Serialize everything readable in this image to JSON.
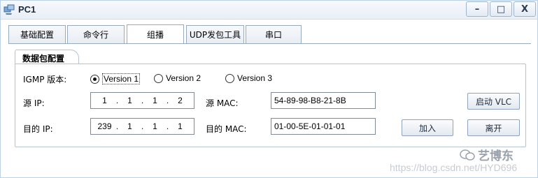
{
  "window": {
    "title": "PC1",
    "controls": {
      "minimize": "–",
      "maximize": "□",
      "close": "X"
    }
  },
  "tabs": [
    {
      "label": "基础配置",
      "active": false
    },
    {
      "label": "命令行",
      "active": false
    },
    {
      "label": "组播",
      "active": true
    },
    {
      "label": "UDP发包工具",
      "active": false
    },
    {
      "label": "串口",
      "active": false
    }
  ],
  "group": {
    "title": "数据包配置",
    "igmp_label": "IGMP 版本:",
    "versions": [
      {
        "label": "Version 1",
        "selected": true
      },
      {
        "label": "Version 2",
        "selected": false
      },
      {
        "label": "Version 3",
        "selected": false
      }
    ],
    "src_ip_label": "源 IP:",
    "src_ip": [
      "1",
      "1",
      "1",
      "2"
    ],
    "src_mac_label": "源  MAC:",
    "src_mac": "54-89-98-B8-21-8B",
    "dst_ip_label": "目的 IP:",
    "dst_ip": [
      "239",
      "1",
      "1",
      "1"
    ],
    "dst_mac_label": "目的 MAC:",
    "dst_mac": "01-00-5E-01-01-01",
    "vlc_button": "启动 VLC",
    "join_button": "加入",
    "leave_button": "离开"
  },
  "watermark": {
    "brand": "艺博东",
    "url": "https://blog.csdn.net/HYD696"
  },
  "colors": {
    "titlebar": "#e9eff7",
    "tab_border": "#9aaabd",
    "group_border": "#b6c3d1",
    "button_border": "#8fa3ba"
  }
}
